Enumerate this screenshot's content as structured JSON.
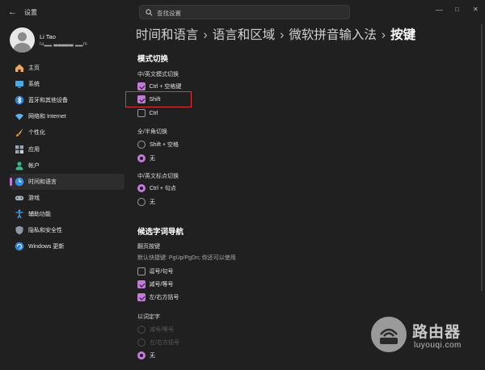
{
  "window": {
    "title": "设置",
    "back_label": "←",
    "minimize": "—",
    "maximize": "□",
    "close": "✕"
  },
  "search": {
    "placeholder": "查找设置"
  },
  "profile": {
    "name": "Li Tao",
    "email": "ta▂▂ ▃▃▃▃▃ ▂▂m"
  },
  "sidebar": {
    "items": [
      {
        "label": "主页",
        "icon": "home-icon"
      },
      {
        "label": "系统",
        "icon": "system-icon"
      },
      {
        "label": "蓝牙和其他设备",
        "icon": "bluetooth-icon"
      },
      {
        "label": "网络和 Internet",
        "icon": "network-icon"
      },
      {
        "label": "个性化",
        "icon": "brush-icon"
      },
      {
        "label": "应用",
        "icon": "apps-icon"
      },
      {
        "label": "帐户",
        "icon": "account-icon"
      },
      {
        "label": "时间和语言",
        "icon": "time-language-icon",
        "active": true
      },
      {
        "label": "游戏",
        "icon": "gaming-icon"
      },
      {
        "label": "辅助功能",
        "icon": "accessibility-icon"
      },
      {
        "label": "隐私和安全性",
        "icon": "shield-icon"
      },
      {
        "label": "Windows 更新",
        "icon": "update-icon"
      }
    ]
  },
  "breadcrumb": {
    "items": [
      "时间和语言",
      "语言和区域",
      "微软拼音输入法",
      "按键"
    ],
    "separator": "›"
  },
  "mode_switch": {
    "title": "模式切换",
    "cn_en": {
      "label": "中/英文模式切换",
      "options": [
        {
          "label": "Ctrl + 空格键",
          "checked": true
        },
        {
          "label": "Shift",
          "checked": true
        },
        {
          "label": "Ctrl",
          "checked": false
        }
      ]
    },
    "full_half": {
      "label": "全/半角切换",
      "options": [
        {
          "label": "Shift + 空格",
          "selected": false
        },
        {
          "label": "无",
          "selected": true
        }
      ]
    },
    "punct": {
      "label": "中/英文标点切换",
      "options": [
        {
          "label": "Ctrl + 句点",
          "selected": true
        },
        {
          "label": "无",
          "selected": false
        }
      ]
    }
  },
  "candidate_nav": {
    "title": "候选字词导航",
    "paging": {
      "label": "翻页按键",
      "hint": "默认快捷键: PgUp/PgDn; 你还可以使用",
      "options": [
        {
          "label": "逗号/句号",
          "checked": false
        },
        {
          "label": "减号/等号",
          "checked": true
        },
        {
          "label": "左/右方括号",
          "checked": true
        }
      ]
    },
    "select_word": {
      "label": "以词定字",
      "options": [
        {
          "label": "减号/等号",
          "selected": false,
          "disabled": true
        },
        {
          "label": "左/右方括号",
          "selected": false,
          "disabled": true
        },
        {
          "label": "无",
          "selected": true,
          "disabled": false
        }
      ]
    }
  },
  "watermark": {
    "text": "路由器",
    "url": "luyouqi.com"
  },
  "colors": {
    "accent": "#c27ad8",
    "highlight_box": "#d83a3a",
    "background": "#202020"
  }
}
